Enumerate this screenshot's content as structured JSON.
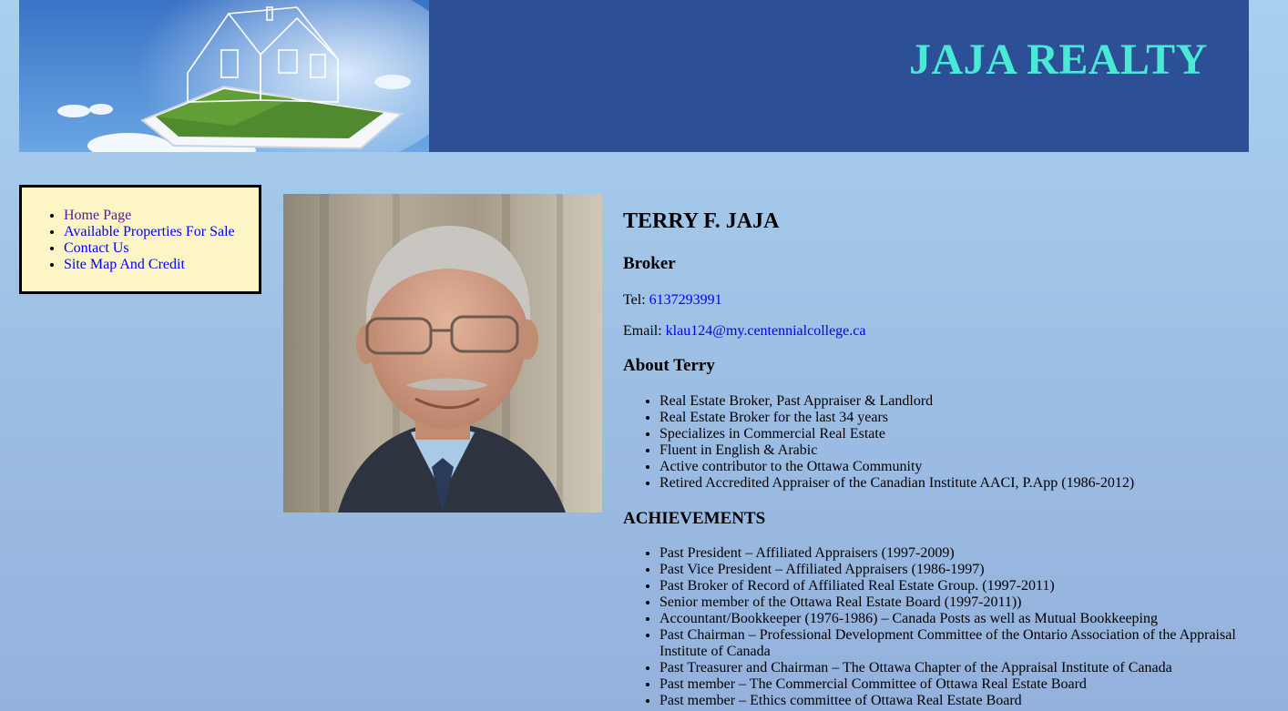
{
  "header": {
    "site_title": "JAJA REALTY"
  },
  "nav": {
    "items": [
      {
        "label": "Home Page",
        "visited": true
      },
      {
        "label": "Available Properties For Sale",
        "visited": false
      },
      {
        "label": "Contact Us",
        "visited": false
      },
      {
        "label": "Site Map And Credit",
        "visited": false
      }
    ]
  },
  "profile": {
    "name": "TERRY F. JAJA",
    "role": "Broker",
    "tel_label": "Tel: ",
    "tel_value": "6137293991",
    "email_label": "Email: ",
    "email_value": "klau124@my.centennialcollege.ca"
  },
  "about": {
    "heading": "About Terry",
    "items": [
      "Real Estate Broker, Past Appraiser & Landlord",
      "Real Estate Broker for the last 34 years",
      "Specializes in Commercial Real Estate",
      "Fluent in English & Arabic",
      "Active contributor to the Ottawa Community",
      "Retired Accredited Appraiser of the Canadian Institute AACI, P.App (1986-2012)"
    ]
  },
  "achievements": {
    "heading": "ACHIEVEMENTS",
    "items": [
      "Past President – Affiliated Appraisers (1997-2009)",
      "Past Vice President – Affiliated Appraisers (1986-1997)",
      "Past Broker of Record of Affiliated Real Estate Group. (1997-2011)",
      "Senior member of the Ottawa Real Estate Board (1997-2011))",
      "Accountant/Bookkeeper (1976-1986) – Canada Posts as well as Mutual Bookkeeping",
      "Past Chairman – Professional Development Committee of the Ontario Association of the Appraisal Institute of Canada",
      "Past Treasurer and Chairman – The Ottawa Chapter of the Appraisal Institute of Canada",
      "Past member – The Commercial Committee of Ottawa Real Estate Board",
      "Past member – Ethics committee of Ottawa Real Estate Board"
    ]
  },
  "colors": {
    "header_bg": "#2c4f96",
    "title": "#4ae9d6",
    "nav_bg": "#fdf5c6",
    "link": "#0000ee",
    "visited_link": "#551a8b"
  }
}
